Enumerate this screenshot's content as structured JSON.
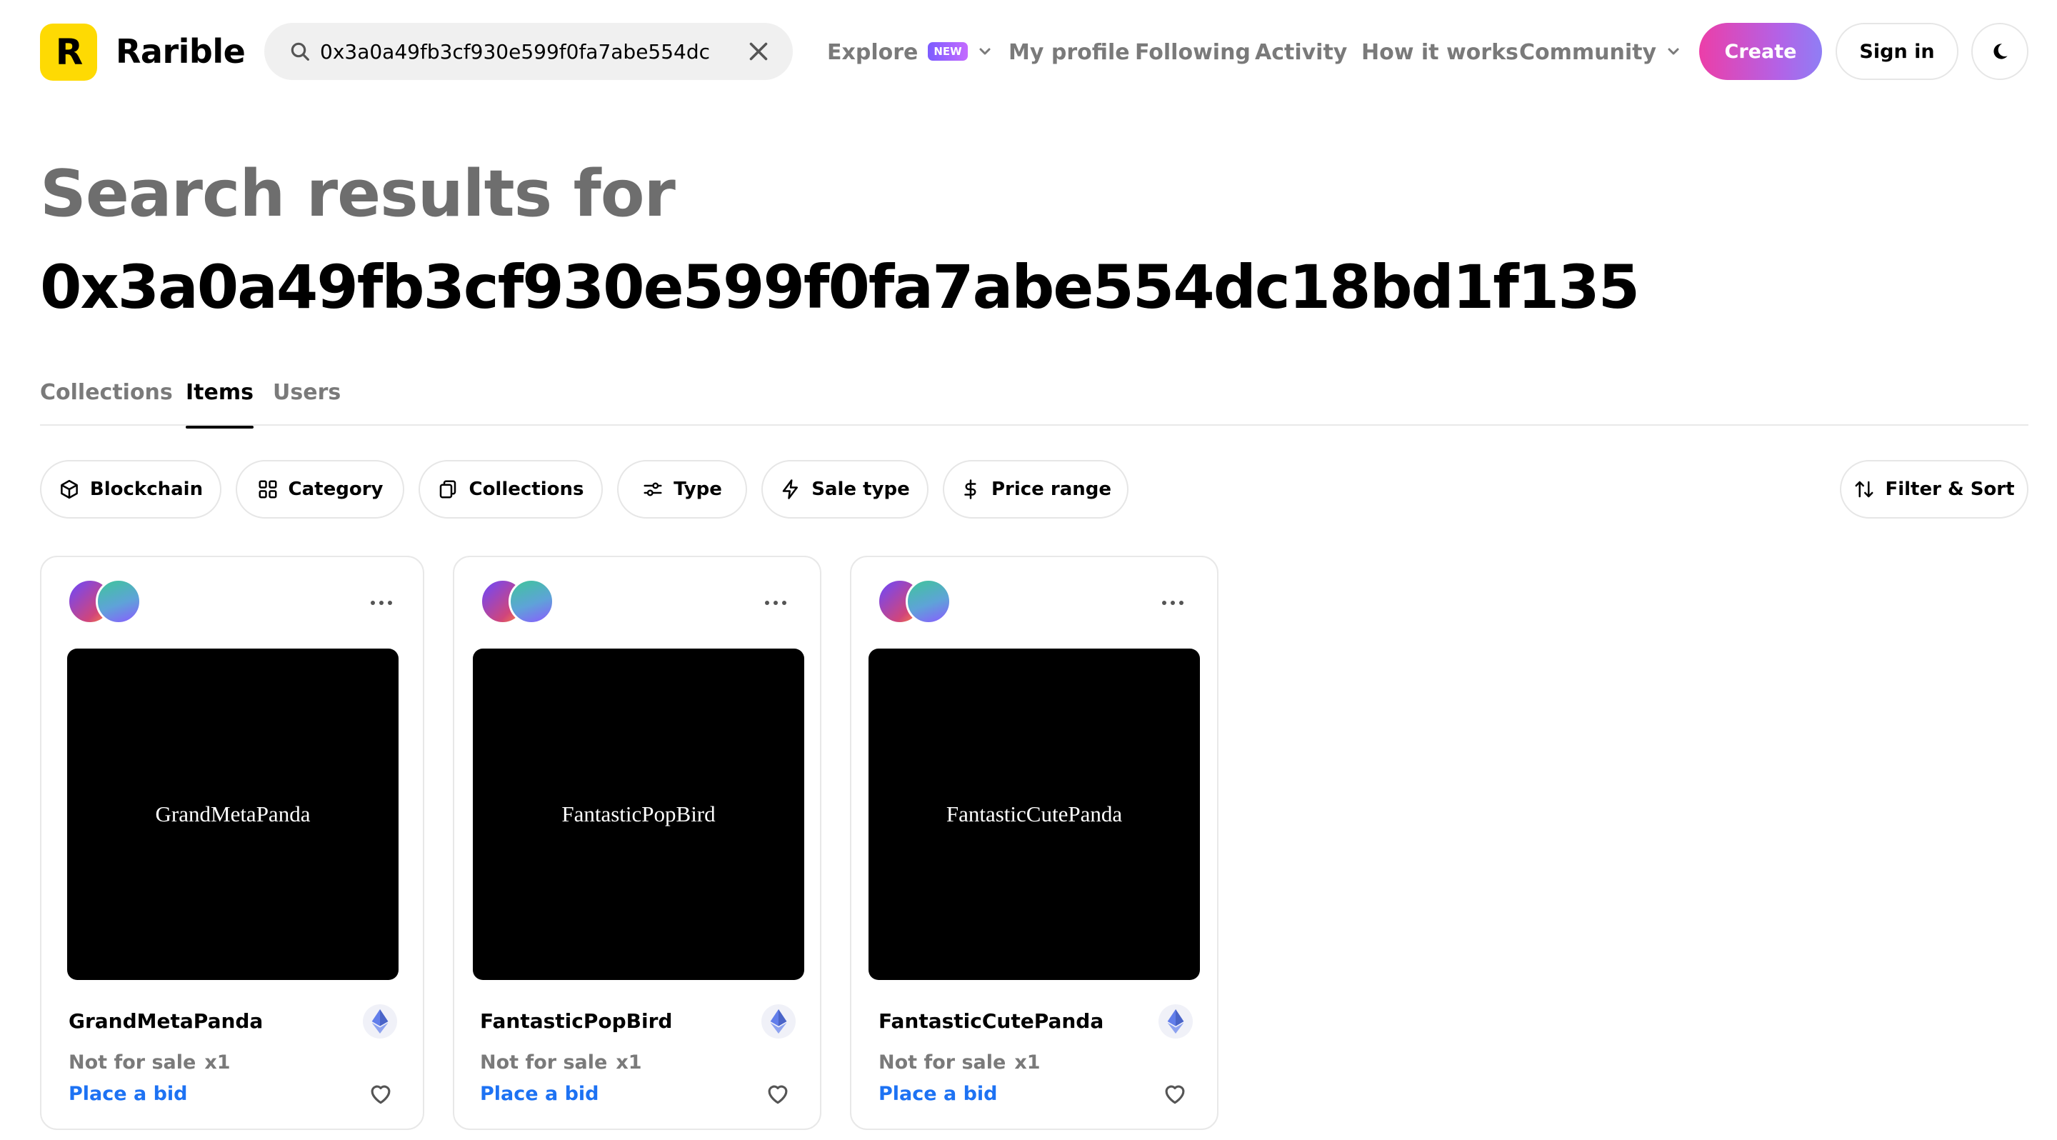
{
  "brand": {
    "name": "Rarible",
    "logo_letter": "R",
    "logo_color": "#FEDA03"
  },
  "search": {
    "value": "0x3a0a49fb3cf930e599f0fa7abe554dc18bd1f135",
    "icon": "search-icon",
    "clear_icon": "close-icon"
  },
  "nav": {
    "explore": "Explore",
    "explore_badge": "NEW",
    "my_profile": "My profile",
    "following": "Following",
    "activity": "Activity",
    "how_it_works": "How it works",
    "community": "Community"
  },
  "actions": {
    "create": "Create",
    "sign_in": "Sign in",
    "theme_icon": "moon-icon"
  },
  "page": {
    "title_prefix": "Search results for",
    "query": "0x3a0a49fb3cf930e599f0fa7abe554dc18bd1f135"
  },
  "tabs": [
    {
      "label": "Collections",
      "active": false
    },
    {
      "label": "Items",
      "active": true
    },
    {
      "label": "Users",
      "active": false
    }
  ],
  "filters": [
    {
      "label": "Blockchain",
      "icon": "cube-icon"
    },
    {
      "label": "Category",
      "icon": "grid-icon"
    },
    {
      "label": "Collections",
      "icon": "collections-icon"
    },
    {
      "label": "Type",
      "icon": "sliders-icon"
    },
    {
      "label": "Sale type",
      "icon": "lightning-icon"
    },
    {
      "label": "Price range",
      "icon": "dollar-icon"
    }
  ],
  "filter_sort": {
    "label": "Filter & Sort",
    "icon": "sort-arrows-icon"
  },
  "items": [
    {
      "image_text": "GrandMetaPanda",
      "name": "GrandMetaPanda",
      "status": "Not for sale",
      "quantity": "x1",
      "action": "Place a bid",
      "chain_icon": "ethereum-icon"
    },
    {
      "image_text": "FantasticPopBird",
      "name": "FantasticPopBird",
      "status": "Not for sale",
      "quantity": "x1",
      "action": "Place a bid",
      "chain_icon": "ethereum-icon"
    },
    {
      "image_text": "FantasticCutePanda",
      "name": "FantasticCutePanda",
      "status": "Not for sale",
      "quantity": "x1",
      "action": "Place a bid",
      "chain_icon": "ethereum-icon"
    }
  ],
  "colors": {
    "accent_link": "#1d72f3",
    "create_gradient_start": "#ec3ea8",
    "create_gradient_end": "#8f7ef5",
    "muted_text": "#7a7a7a"
  }
}
